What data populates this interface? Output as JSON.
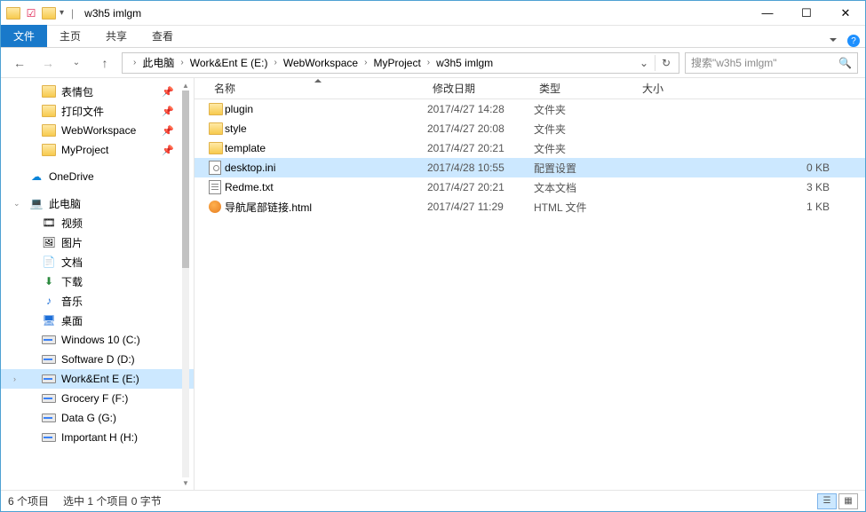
{
  "title": "w3h5 imlgm",
  "ribbon": {
    "file": "文件",
    "tabs": [
      "主页",
      "共享",
      "查看"
    ]
  },
  "breadcrumb": [
    "此电脑",
    "Work&Ent E (E:)",
    "WebWorkspace",
    "MyProject",
    "w3h5 imlgm"
  ],
  "search_placeholder": "搜索\"w3h5 imlgm\"",
  "nav": {
    "quick": [
      {
        "label": "表情包",
        "pin": true
      },
      {
        "label": "打印文件",
        "pin": true
      },
      {
        "label": "WebWorkspace",
        "pin": true
      },
      {
        "label": "MyProject",
        "pin": true
      }
    ],
    "onedrive": "OneDrive",
    "thispc": "此电脑",
    "libs": [
      "视频",
      "图片",
      "文档",
      "下载",
      "音乐",
      "桌面"
    ],
    "drives": [
      "Windows 10 (C:)",
      "Software D (D:)",
      "Work&Ent E (E:)",
      "Grocery F (F:)",
      "Data G (G:)",
      "Important H (H:)"
    ]
  },
  "columns": {
    "name": "名称",
    "date": "修改日期",
    "type": "类型",
    "size": "大小"
  },
  "files": [
    {
      "name": "plugin",
      "date": "2017/4/27 14:28",
      "type": "文件夹",
      "size": "",
      "icon": "folder",
      "selected": false
    },
    {
      "name": "style",
      "date": "2017/4/27 20:08",
      "type": "文件夹",
      "size": "",
      "icon": "folder",
      "selected": false
    },
    {
      "name": "template",
      "date": "2017/4/27 20:21",
      "type": "文件夹",
      "size": "",
      "icon": "folder",
      "selected": false
    },
    {
      "name": "desktop.ini",
      "date": "2017/4/28 10:55",
      "type": "配置设置",
      "size": "0 KB",
      "icon": "ini",
      "selected": true
    },
    {
      "name": "Redme.txt",
      "date": "2017/4/27 20:21",
      "type": "文本文档",
      "size": "3 KB",
      "icon": "txt",
      "selected": false
    },
    {
      "name": "导航尾部链接.html",
      "date": "2017/4/27 11:29",
      "type": "HTML 文件",
      "size": "1 KB",
      "icon": "html",
      "selected": false
    }
  ],
  "status": {
    "count": "6 个项目",
    "selected": "选中 1 个项目 0 字节"
  }
}
